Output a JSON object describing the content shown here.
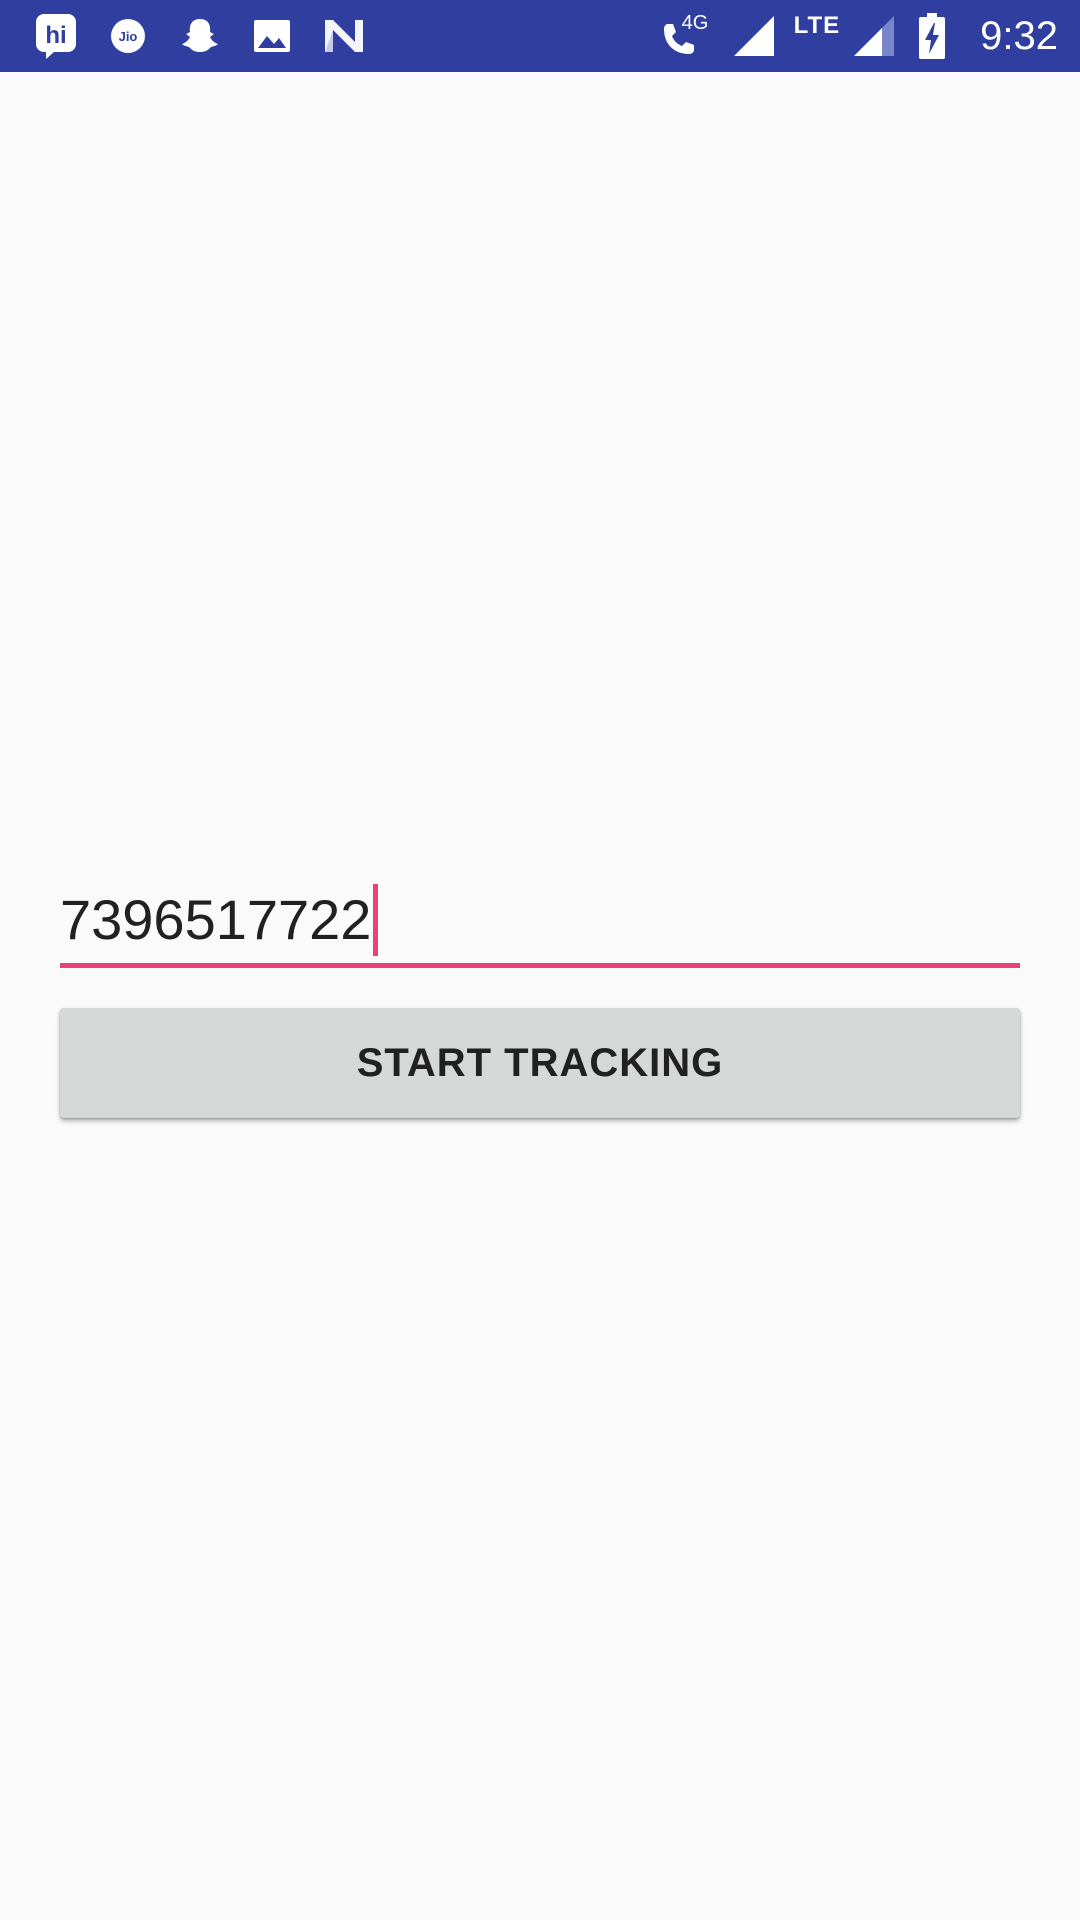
{
  "status_bar": {
    "background": "#303f9f",
    "left_icons": [
      "hike-icon",
      "jio-icon",
      "snapchat-icon",
      "gallery-icon",
      "n-app-icon"
    ],
    "right_icons": [
      "volte-call-icon",
      "signal-icon",
      "signal-weak-icon",
      "battery-charging-icon"
    ],
    "call_network": "4G",
    "network_type": "LTE",
    "time": "9:32"
  },
  "form": {
    "phone_input": {
      "value": "7396517722",
      "accent_color": "#ec407a"
    },
    "start_button": {
      "label": "START TRACKING"
    }
  }
}
